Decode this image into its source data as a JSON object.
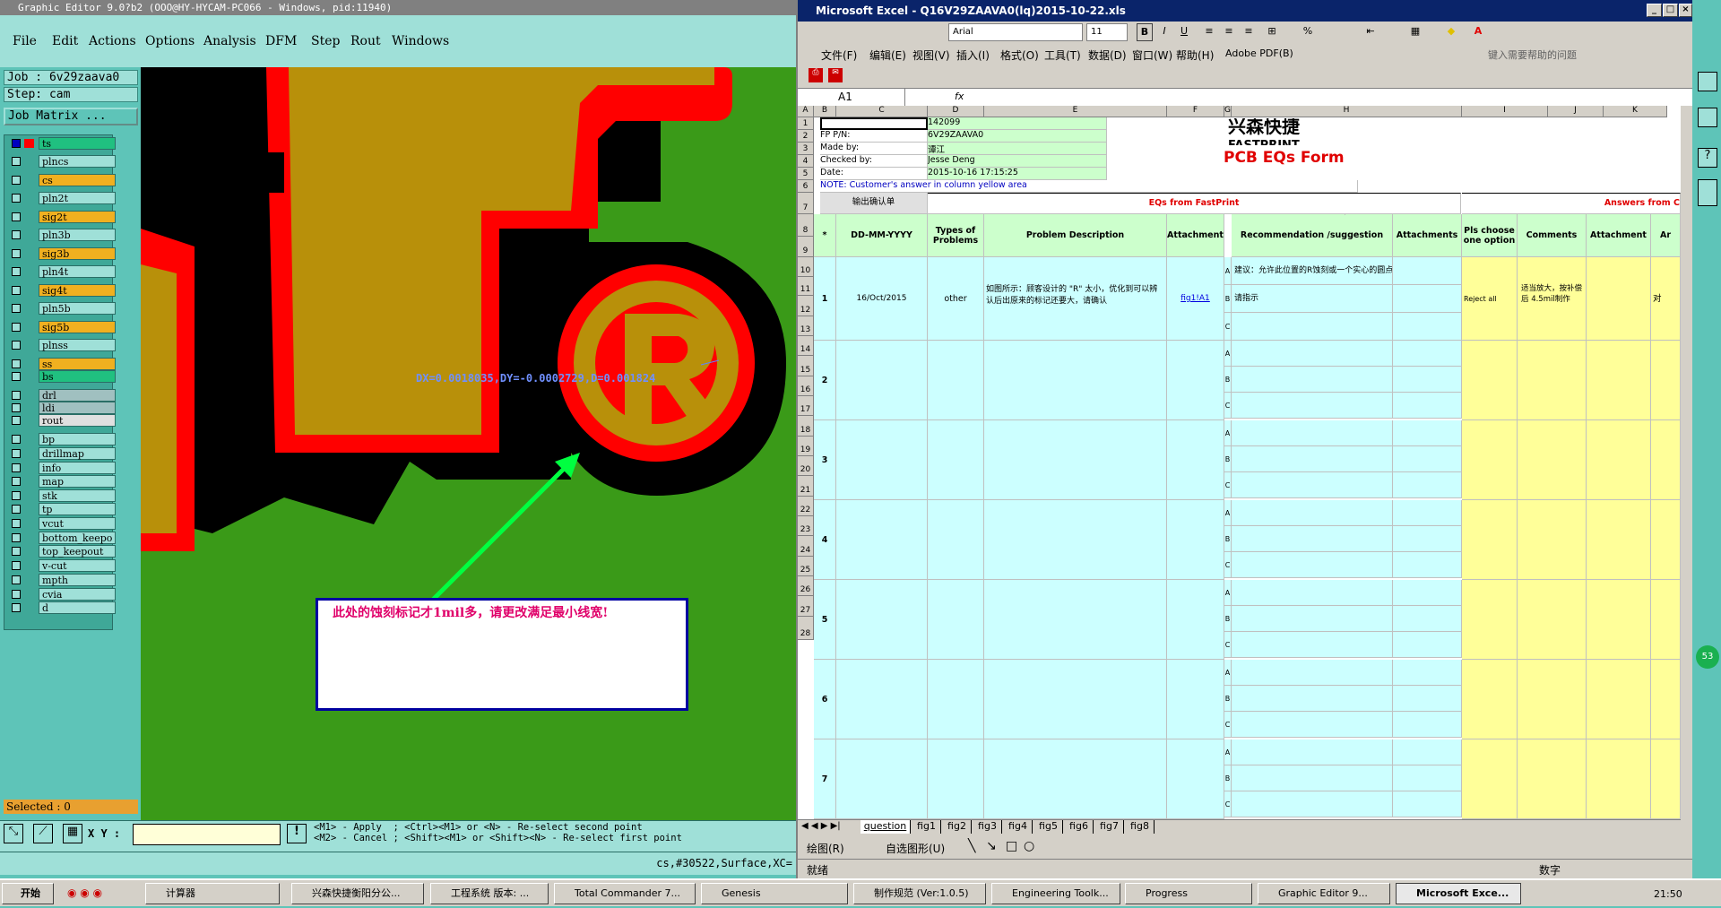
{
  "genesis": {
    "title": "Graphic Editor 9.0?b2 (OOO@HY-HYCAM-PC066 - Windows, pid:11940)",
    "menu": [
      "File",
      "Edit",
      "Actions",
      "Options",
      "Analysis",
      "DFM",
      "Step",
      "Rout",
      "Windows"
    ],
    "job": "Job : 6v29zaava0",
    "step": "Step: cam",
    "matrix_button": "Job Matrix ...",
    "layers": [
      {
        "name": "ts",
        "color": "#20c080"
      },
      {
        "name": "plncs",
        "color": "#9fe0d8"
      },
      {
        "name": "cs",
        "color": "#f0b020"
      },
      {
        "name": "pln2t",
        "color": "#9fe0d8"
      },
      {
        "name": "sig2t",
        "color": "#f0b020"
      },
      {
        "name": "pln3b",
        "color": "#9fe0d8"
      },
      {
        "name": "sig3b",
        "color": "#f0b020"
      },
      {
        "name": "pln4t",
        "color": "#9fe0d8"
      },
      {
        "name": "sig4t",
        "color": "#f0b020"
      },
      {
        "name": "pln5b",
        "color": "#9fe0d8"
      },
      {
        "name": "sig5b",
        "color": "#f0b020"
      },
      {
        "name": "plnss",
        "color": "#9fe0d8"
      },
      {
        "name": "ss",
        "color": "#f0b020"
      },
      {
        "name": "bs",
        "color": "#20c080"
      },
      {
        "name": "drl",
        "color": "#a0c0c0"
      },
      {
        "name": "ldi",
        "color": "#a0c0c0"
      },
      {
        "name": "rout",
        "color": "#e0e0e0"
      },
      {
        "name": "bp",
        "color": "#9fe0d8"
      },
      {
        "name": "drillmap",
        "color": "#9fe0d8"
      },
      {
        "name": "info",
        "color": "#9fe0d8"
      },
      {
        "name": "map",
        "color": "#9fe0d8"
      },
      {
        "name": "stk",
        "color": "#9fe0d8"
      },
      {
        "name": "tp",
        "color": "#9fe0d8"
      },
      {
        "name": "vcut",
        "color": "#9fe0d8"
      },
      {
        "name": "bottom_keepo",
        "color": "#9fe0d8"
      },
      {
        "name": "top_keepout",
        "color": "#9fe0d8"
      },
      {
        "name": "v-cut",
        "color": "#9fe0d8"
      },
      {
        "name": "mpth",
        "color": "#9fe0d8"
      },
      {
        "name": "cvia",
        "color": "#9fe0d8"
      },
      {
        "name": "d",
        "color": "#9fe0d8"
      }
    ],
    "measure_text": "DX=0.0018035,DY=-0.0002729,D=0.001824",
    "callout_text": "此处的蚀刻标记才1mil多，请更改满足最小线宽!",
    "selected": "Selected : 0",
    "xy_label": "X Y :",
    "help_line1": "<M1> - Apply  ; <Ctrl><M1> or <N> - Re-select second point",
    "help_line2": "<M2> - Cancel ; <Shift><M1> or <Shift><N> - Re-select first point",
    "status": "cs,#30522,Surface,XC="
  },
  "excel": {
    "title": "Microsoft Excel - Q16V29ZAAVA0(lq)2015-10-22.xls",
    "font_name": "Arial",
    "font_size": "11",
    "menu": [
      "文件(F)",
      "编辑(E)",
      "视图(V)",
      "插入(I)",
      "格式(O)",
      "工具(T)",
      "数据(D)",
      "窗口(W)",
      "帮助(H)",
      "Adobe PDF(B)"
    ],
    "help_placeholder": "键入需要帮助的问题",
    "namebox": "A1",
    "fx": "fx",
    "cols": [
      "A",
      "B",
      "C",
      "D",
      "E",
      "F",
      "G",
      "H",
      "I",
      "J",
      "K"
    ],
    "info": {
      "pn_value": "142099",
      "fp_label": "FP P/N:",
      "fp_value": "6V29ZAAVA0",
      "made_label": "Made by:",
      "made_value": "谭江",
      "checked_label": "Checked by:",
      "checked_value": "Jesse Deng",
      "date_label": "Date:",
      "date_value": "2015-10-16 17:15:25",
      "note": "NOTE: Customer's  answer in column yellow area",
      "logo_cn": "兴森快捷",
      "logo_en": "FASTPRINT",
      "form_title": "PCB EQs Form"
    },
    "section": {
      "b7": "输出确认单",
      "eqs": "EQs from FastPrint",
      "answers": "Answers from C"
    },
    "headers": {
      "a": "*",
      "date": "DD-MM-YYYY",
      "types": "Types of Problems",
      "desc": "Problem Description",
      "attach": "Attachment",
      "rec": "Recommendation /suggestion",
      "attachments": "Attachments",
      "pls": "Pls choose one option",
      "comments": "Comments",
      "attach2": "Attachment",
      "ar": "Ar"
    },
    "row1": {
      "num": "1",
      "date": "16/Oct/2015",
      "type": "other",
      "desc": "如图所示：顾客设计的 \"R\" 太小，优化到可以辨认后出原来的标记还要大，请确认",
      "link": "fig1!A1",
      "rec_a": "建议：允许此位置的R蚀刻或一个实心的圆点",
      "rec_b": "请指示",
      "pls": "Reject all",
      "comment": "适当放大，按补偿后 4.5mil制作",
      "extra": "对"
    },
    "groups": [
      "2",
      "3",
      "4",
      "5",
      "6",
      "7"
    ],
    "abc": [
      "A",
      "B",
      "C"
    ],
    "row_nums": [
      "1",
      "2",
      "3",
      "4",
      "5",
      "6",
      "7",
      "8",
      "9",
      "10",
      "11",
      "12",
      "13",
      "14",
      "15",
      "16",
      "17",
      "18",
      "19",
      "20",
      "21",
      "22",
      "23",
      "24",
      "25",
      "26",
      "27",
      "28"
    ],
    "tabs": [
      "question",
      "fig1",
      "fig2",
      "fig3",
      "fig4",
      "fig5",
      "fig6",
      "fig7",
      "fig8"
    ],
    "draw_label": "绘图(R)",
    "autoshape_label": "自选图形(U)",
    "status_ready": "就绪",
    "status_num": "数字"
  },
  "taskbar": {
    "start": "开始",
    "tasks": [
      "计算器",
      "兴森快捷衡阳分公...",
      "工程系统  版本: ...",
      "Total Commander 7...",
      "Genesis",
      "制作规范 (Ver:1.0.5)",
      "Engineering Toolk...",
      "Progress",
      "Graphic Editor 9...",
      "Microsoft Exce..."
    ],
    "clock": "21:50"
  }
}
